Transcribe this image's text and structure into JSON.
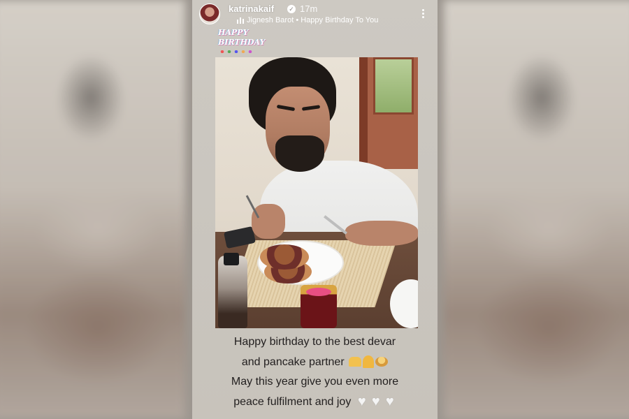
{
  "story": {
    "username": "katrinakaif",
    "verified_icon": "verified-badge-icon",
    "time_ago": "17m",
    "music": {
      "icon": "music-bars-icon",
      "artist": "Jignesh Barot",
      "separator": "•",
      "song": "Happy Birthday To You"
    },
    "sticker": {
      "line1": "HAPPY",
      "line2": "BIRTHDAY"
    },
    "more_icon": "more-vertical-icon"
  },
  "caption": {
    "line1": "Happy birthday to the best devar",
    "line2": "and  pancake partner",
    "line3": "May this year give you even more",
    "line4": "peace fulfilment and joy",
    "emojis_line2": [
      "heart-hands-emoji",
      "folded-hands-emoji",
      "pancakes-emoji"
    ],
    "emojis_line4": [
      "white-heart-emoji",
      "white-heart-emoji",
      "white-heart-emoji"
    ],
    "heart_glyph": "♥"
  },
  "colors": {
    "story_bg": "#cac6bf",
    "caption_text": "#232020",
    "header_text": "#ffffff"
  }
}
